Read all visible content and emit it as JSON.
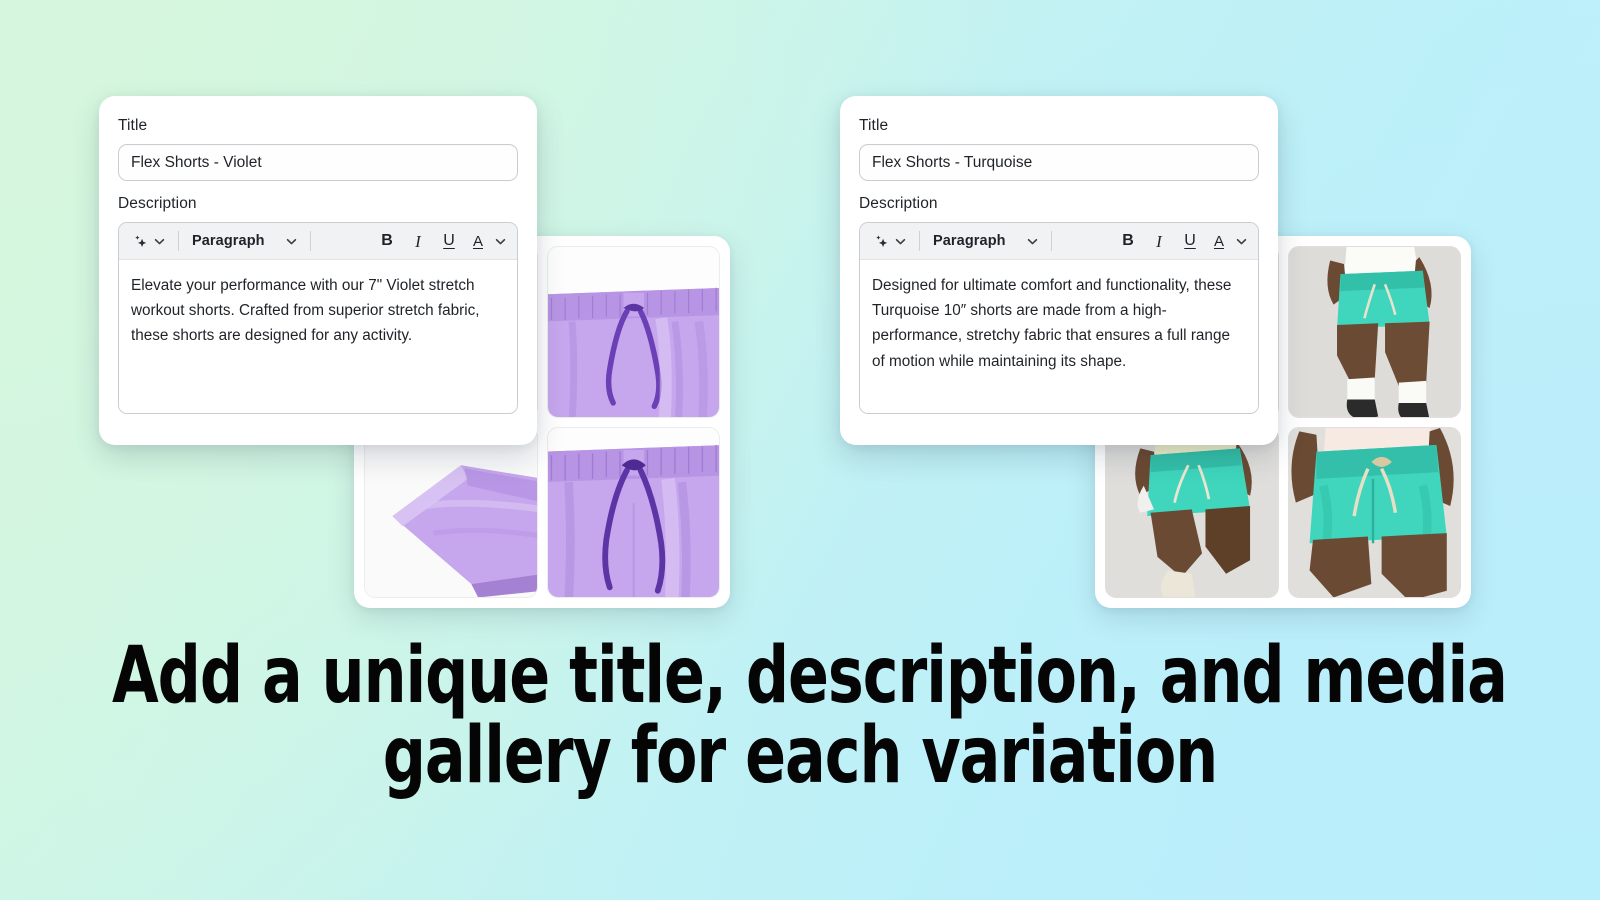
{
  "background": {
    "gradient_from": "#d5f7dd",
    "gradient_mid": "#c3f2f2",
    "gradient_to": "#bfeefc"
  },
  "headline": {
    "line1": "Add a unique title, description, and media",
    "line2": "gallery for each variation"
  },
  "cards": [
    {
      "id": "violet",
      "title_label": "Title",
      "title_value": "Flex Shorts - Violet",
      "title_placeholder": "Product title",
      "description_label": "Description",
      "description_value": "Elevate your performance with our 7\" Violet stretch workout shorts. Crafted from superior stretch fabric, these shorts are designed for any activity.",
      "toolbar": {
        "ai_icon": "sparkle-icon",
        "ai_chevron_icon": "chevron-down-icon",
        "block_style": "Paragraph",
        "block_style_chevron_icon": "chevron-down-icon",
        "bold_label": "B",
        "italic_label": "I",
        "underline_label": "U",
        "text_color_label": "A",
        "text_color_chevron_icon": "chevron-down-icon"
      }
    },
    {
      "id": "turquoise",
      "title_label": "Title",
      "title_value": "Flex Shorts - Turquoise",
      "title_placeholder": "Product title",
      "description_label": "Description",
      "description_value": "Designed for ultimate comfort and functionality, these Turquoise 10″ shorts are made from a high-performance, stretchy fabric that ensures a full range of motion while maintaining its shape.",
      "toolbar": {
        "ai_icon": "sparkle-icon",
        "ai_chevron_icon": "chevron-down-icon",
        "block_style": "Paragraph",
        "block_style_chevron_icon": "chevron-down-icon",
        "bold_label": "B",
        "italic_label": "I",
        "underline_label": "U",
        "text_color_label": "A",
        "text_color_chevron_icon": "chevron-down-icon"
      }
    }
  ],
  "galleries": [
    {
      "id": "violet-gallery",
      "product_color": "#c2a2e8",
      "background_color": "#ffffff",
      "tiles": [
        {
          "name": "violet-shorts-leg-closeup",
          "alt": "Violet shorts leg close-up on white"
        },
        {
          "name": "violet-shorts-waistband",
          "alt": "Violet shorts waistband with drawstring"
        },
        {
          "name": "violet-shorts-folded-hem",
          "alt": "Folded violet shorts hem on white"
        },
        {
          "name": "violet-shorts-drawstring",
          "alt": "Violet shorts drawstring detail"
        }
      ]
    },
    {
      "id": "turquoise-gallery",
      "product_color": "#3ad4be",
      "background_color": "#e2e1df",
      "tiles": [
        {
          "name": "turquoise-shorts-model-front",
          "alt": "Model wearing turquoise shorts, front view"
        },
        {
          "name": "turquoise-shorts-model-walking",
          "alt": "Model walking in turquoise shorts"
        },
        {
          "name": "turquoise-shorts-model-side",
          "alt": "Model in turquoise shorts, side step"
        },
        {
          "name": "turquoise-shorts-model-detail",
          "alt": "Turquoise shorts waistband detail on model"
        }
      ]
    }
  ]
}
